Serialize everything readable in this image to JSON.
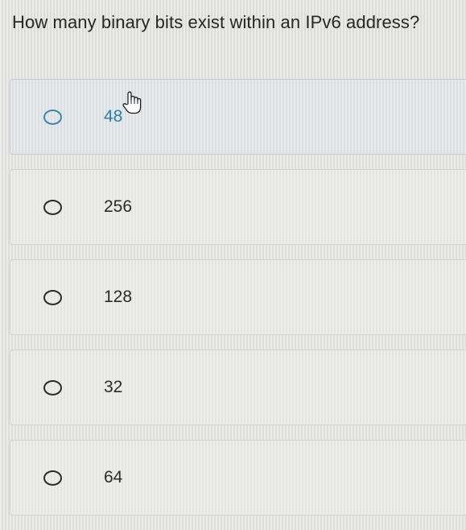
{
  "question": "How many binary bits exist within an IPv6 address?",
  "options": [
    {
      "label": "48"
    },
    {
      "label": "256"
    },
    {
      "label": "128"
    },
    {
      "label": "32"
    },
    {
      "label": "64"
    }
  ],
  "colors": {
    "accent": "#3f87a6",
    "text": "#2b2b2b"
  },
  "cursor_icon": "hand-pointer-icon"
}
